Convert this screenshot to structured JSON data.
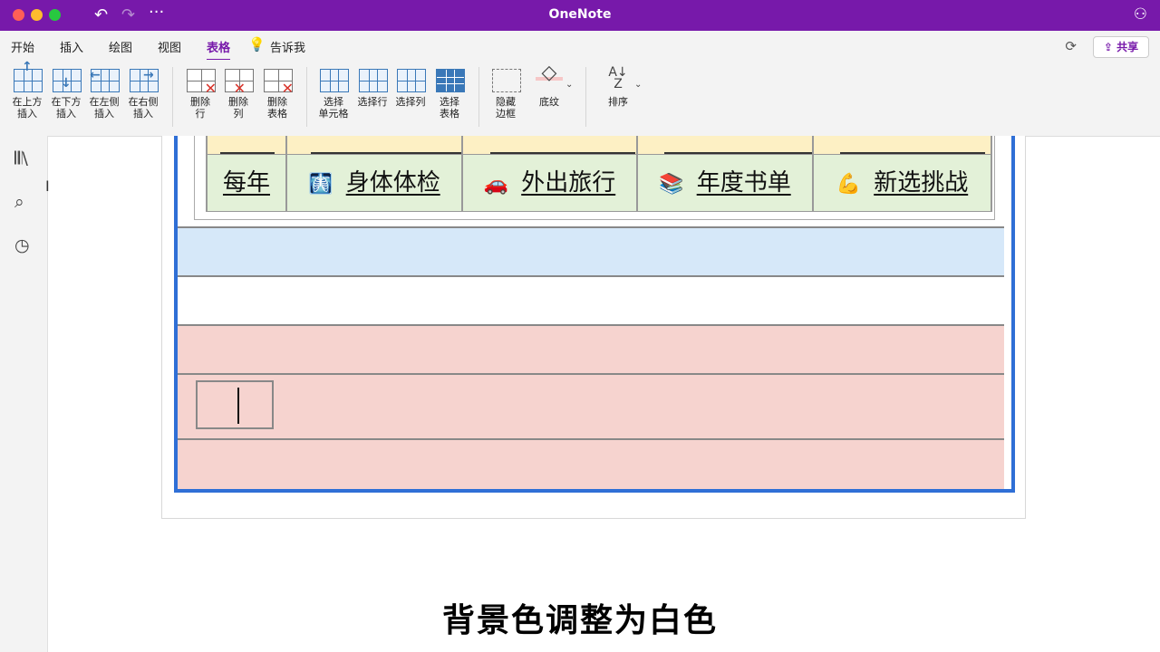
{
  "window": {
    "title": "OneNote"
  },
  "menu": {
    "tabs": [
      "开始",
      "插入",
      "绘图",
      "视图",
      "表格"
    ],
    "active_tab": "表格",
    "tell_me": "告诉我",
    "share_label": "共享"
  },
  "ribbon": {
    "insert_above": "在上方\n插入",
    "insert_below": "在下方\n插入",
    "insert_left": "在左侧\n插入",
    "insert_right": "在右侧\n插入",
    "delete_row": "删除\n行",
    "delete_col": "删除\n列",
    "delete_table": "删除\n表格",
    "select_cell": "选择\n单元格",
    "select_row": "选择行",
    "select_col": "选择列",
    "select_table": "选择\n表格",
    "hide_borders": "隐藏\n边框",
    "shading": "底纹",
    "sort": "排序"
  },
  "table": {
    "row": [
      {
        "label": "每年",
        "emoji": ""
      },
      {
        "label": "身体体检",
        "emoji": "🩻"
      },
      {
        "label": "外出旅行",
        "emoji": "🚗"
      },
      {
        "label": "年度书单",
        "emoji": "📚"
      },
      {
        "label": "新选挑战",
        "emoji": "💪"
      }
    ]
  },
  "colors": {
    "accent": "#7719aa",
    "table_border": "#2f6fd6",
    "row_blue": "#d6e8f9",
    "row_pink": "#f6d3cf",
    "row_green": "#e3f1d8",
    "row_yellow": "#fdf0c4"
  },
  "caption": "背景色调整为白色"
}
